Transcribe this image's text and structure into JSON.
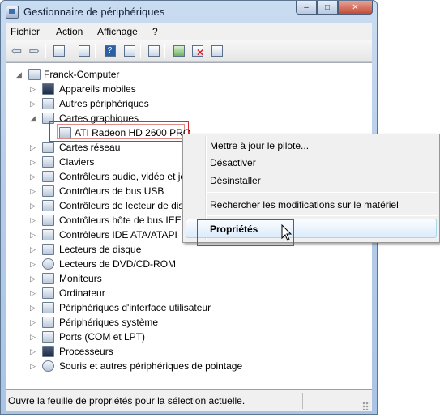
{
  "window": {
    "title": "Gestionnaire de périphériques",
    "buttons": {
      "minimize": "–",
      "maximize": "□",
      "close": "✕"
    }
  },
  "menubar": [
    "Fichier",
    "Action",
    "Affichage",
    "?"
  ],
  "toolbar": {
    "icons": [
      "back-arrow-icon",
      "forward-arrow-icon",
      "console-tree-icon",
      "properties-icon",
      "help-icon",
      "view-icon",
      "scan-hardware-icon",
      "update-driver-icon",
      "uninstall-icon",
      "enable-device-icon"
    ]
  },
  "tree": {
    "root": "Franck-Computer",
    "items": [
      {
        "label": "Appareils mobiles",
        "expander": "▷"
      },
      {
        "label": "Autres périphériques",
        "expander": "▷"
      },
      {
        "label": "Cartes graphiques",
        "expander": "◢"
      },
      {
        "label": "ATI Radeon HD 2600 PRO",
        "expander": ""
      },
      {
        "label": "Cartes réseau",
        "expander": "▷"
      },
      {
        "label": "Claviers",
        "expander": "▷"
      },
      {
        "label": "Contrôleurs audio, vidéo et je",
        "expander": "▷"
      },
      {
        "label": "Contrôleurs de bus USB",
        "expander": "▷"
      },
      {
        "label": "Contrôleurs de lecteur de dis",
        "expander": "▷"
      },
      {
        "label": "Contrôleurs hôte de bus IEEE",
        "expander": "▷"
      },
      {
        "label": "Contrôleurs IDE ATA/ATAPI",
        "expander": "▷"
      },
      {
        "label": "Lecteurs de disque",
        "expander": "▷"
      },
      {
        "label": "Lecteurs de DVD/CD-ROM",
        "expander": "▷"
      },
      {
        "label": "Moniteurs",
        "expander": "▷"
      },
      {
        "label": "Ordinateur",
        "expander": "▷"
      },
      {
        "label": "Périphériques d'interface utilisateur",
        "expander": "▷"
      },
      {
        "label": "Périphériques système",
        "expander": "▷"
      },
      {
        "label": "Ports (COM et LPT)",
        "expander": "▷"
      },
      {
        "label": "Processeurs",
        "expander": "▷"
      },
      {
        "label": "Souris et autres périphériques de pointage",
        "expander": "▷"
      }
    ]
  },
  "context_menu": {
    "items": [
      "Mettre à jour le pilote...",
      "Désactiver",
      "Désinstaller",
      "Rechercher les modifications sur le matériel",
      "Propriétés"
    ]
  },
  "status": {
    "text": "Ouvre la feuille de propriétés pour la sélection actuelle."
  }
}
